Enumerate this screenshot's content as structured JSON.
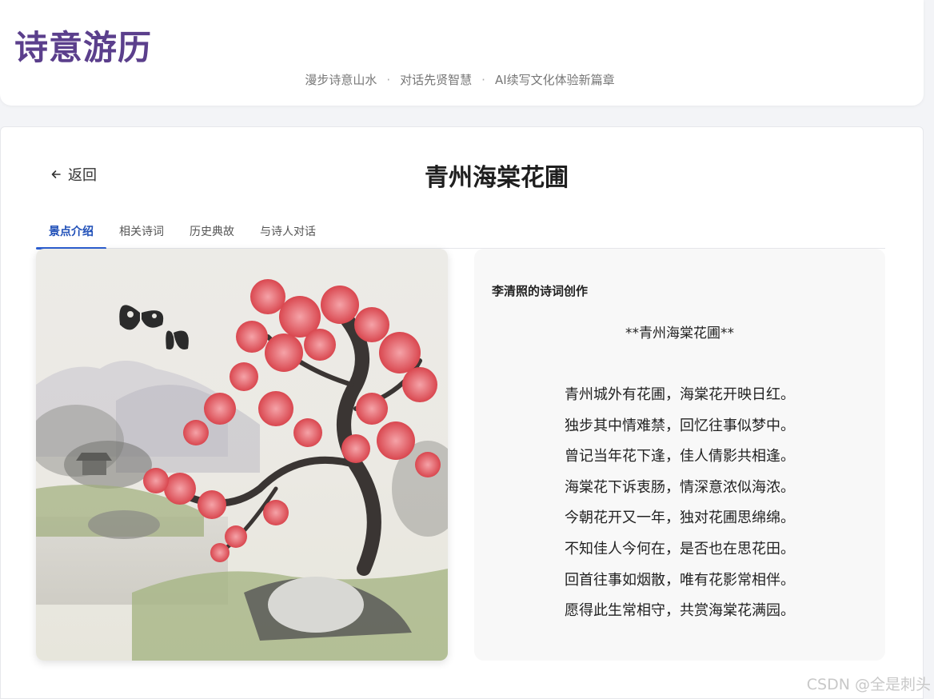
{
  "header": {
    "site_title": "诗意游历",
    "tagline": [
      "漫步诗意山水",
      "对话先贤智慧",
      "AI续写文化体验新篇章"
    ]
  },
  "detail": {
    "back_label": "返回",
    "title": "青州海棠花圃"
  },
  "tabs": [
    {
      "label": "景点介绍",
      "active": true
    },
    {
      "label": "相关诗词",
      "active": false
    },
    {
      "label": "历史典故",
      "active": false
    },
    {
      "label": "与诗人对话",
      "active": false
    }
  ],
  "painting": {
    "subject": "ink-wash painting of a flowering crabapple tree with butterflies"
  },
  "poem": {
    "heading": "李清照的诗词创作",
    "title": "**青州海棠花圃**",
    "lines": [
      "青州城外有花圃，海棠花开映日红。",
      "独步其中情难禁，回忆往事似梦中。",
      "曾记当年花下逢，佳人倩影共相逢。",
      "海棠花下诉衷肠，情深意浓似海浓。",
      "今朝花开又一年，独对花圃思绵绵。",
      "不知佳人今何在，是否也在思花田。",
      "回首往事如烟散，唯有花影常相伴。",
      "愿得此生常相守，共赏海棠花满园。"
    ]
  },
  "watermark": "CSDN @全是刺头",
  "colors": {
    "brand": "#5b3f8c",
    "tab_active": "#2d5fd1",
    "background": "#f3f4f7"
  }
}
